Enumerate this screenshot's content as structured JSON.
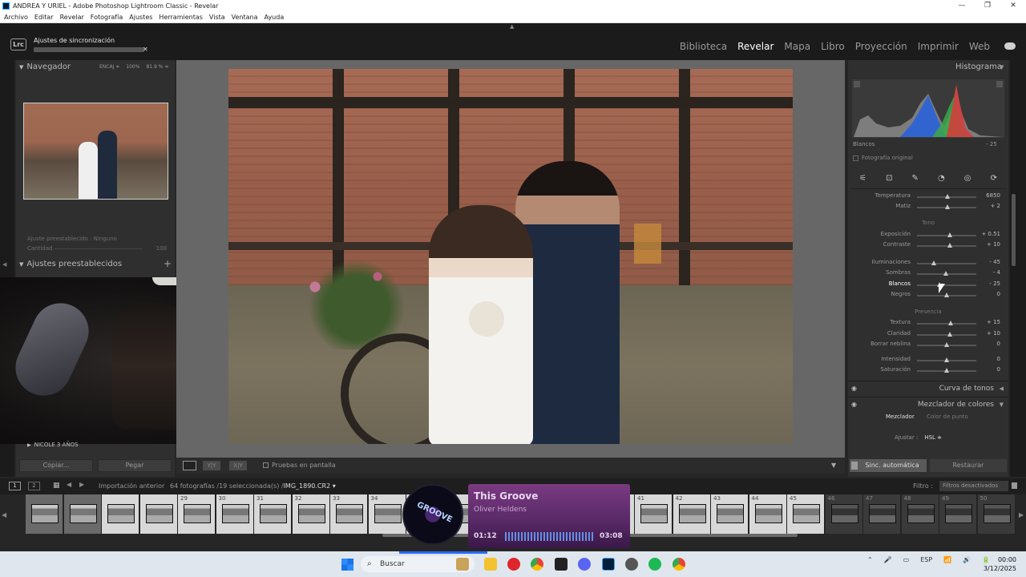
{
  "window": {
    "title": "ANDREA Y URIEL - Adobe Photoshop Lightroom Classic - Revelar",
    "controls": [
      "—",
      "❐",
      "✕"
    ]
  },
  "menu": [
    "Archivo",
    "Editar",
    "Revelar",
    "Fotografía",
    "Ajustes",
    "Herramientas",
    "Vista",
    "Ventana",
    "Ayuda"
  ],
  "identity": {
    "logo": "Lrc",
    "sync_label": "Ajustes de sincronización",
    "close": "✕"
  },
  "modules": [
    "Biblioteca",
    "Revelar",
    "Mapa",
    "Libro",
    "Proyección",
    "Imprimir",
    "Web"
  ],
  "active_module": "Revelar",
  "left": {
    "navigator_title": "Navegador",
    "zoom_options": [
      "ENCAJ ≑",
      "100%",
      "81.9 % ≑"
    ],
    "preset_mini": {
      "label": "Ajuste preestablecido",
      "value": "Ninguno",
      "amount_label": "Cantidad",
      "amount_value": "100"
    },
    "presets_title": "Ajustes preestablecidos",
    "presets_add": "+",
    "folder_item": "NICOLE 3 AÑOS",
    "copy_button": "Copiar...",
    "paste_button": "Pegar"
  },
  "center_toolbar": {
    "softproof": "Pruebas en pantalla",
    "view_yy": "Y|Y",
    "view_xy": "X|Y",
    "menu_arrow": "▼"
  },
  "right": {
    "histogram_title": "Histograma",
    "histogram_label": "Blancos",
    "histogram_value": "- 25",
    "original_photo": "Fotografía original",
    "tools": [
      "⚟",
      "⊡",
      "✎",
      "◔",
      "◎",
      "⟳"
    ],
    "rows_top": [
      {
        "label": "Temperatura",
        "value": "6850",
        "pos": 0.52
      },
      {
        "label": "Matiz",
        "value": "+ 2",
        "pos": 0.51
      }
    ],
    "tone_label": "Tono",
    "tone_rows": [
      {
        "label": "Exposición",
        "value": "+ 0.51",
        "pos": 0.56
      },
      {
        "label": "Contraste",
        "value": "+ 10",
        "pos": 0.55
      }
    ],
    "tone_rows2": [
      {
        "label": "Iluminaciones",
        "value": "- 45",
        "pos": 0.28
      },
      {
        "label": "Sombras",
        "value": "- 4",
        "pos": 0.48
      },
      {
        "label": "Blancos",
        "value": "- 25",
        "pos": 0.38
      },
      {
        "label": "Negros",
        "value": "0",
        "pos": 0.5
      }
    ],
    "presence_label": "Presencia",
    "presence_rows": [
      {
        "label": "Textura",
        "value": "+ 15",
        "pos": 0.57
      },
      {
        "label": "Claridad",
        "value": "+ 10",
        "pos": 0.55
      },
      {
        "label": "Borrar neblina",
        "value": "0",
        "pos": 0.5
      }
    ],
    "color_rows": [
      {
        "label": "Intensidad",
        "value": "0",
        "pos": 0.5
      },
      {
        "label": "Saturación",
        "value": "0",
        "pos": 0.5
      }
    ],
    "tone_curve": "Curva de tonos",
    "color_mixer": "Mezclador de colores",
    "mixer_tab_1": "Mezclador",
    "mixer_tab_2": "Color de punto",
    "adjust_label": "Ajustar :",
    "adjust_value": "HSL ≑",
    "sync_auto": "Sinc. automática",
    "reset": "Restaurar"
  },
  "filmstrip_nav": {
    "page1": "1",
    "page2": "2",
    "source": "Importación anterior",
    "count_text": "64 fotografías /19 seleccionada(s) /",
    "file": "IMG_1890.CR2 ▾",
    "filter_label": "Filtro :",
    "filter_value": "Filtros desactivados"
  },
  "filmstrip": [
    {
      "n": "",
      "state": "sel2"
    },
    {
      "n": "",
      "state": "sel2"
    },
    {
      "n": "",
      "state": "sel"
    },
    {
      "n": "",
      "state": "sel"
    },
    {
      "n": "29",
      "state": "sel"
    },
    {
      "n": "30",
      "state": "sel"
    },
    {
      "n": "31",
      "state": "sel"
    },
    {
      "n": "32",
      "state": "sel"
    },
    {
      "n": "33",
      "state": "sel"
    },
    {
      "n": "34",
      "state": "sel"
    },
    {
      "n": "",
      "state": "sel"
    },
    {
      "n": "",
      "state": "sel"
    },
    {
      "n": "",
      "state": "sel"
    },
    {
      "n": "",
      "state": "sel"
    },
    {
      "n": "",
      "state": "sel"
    },
    {
      "n": "",
      "state": "sel"
    },
    {
      "n": "41",
      "state": "sel"
    },
    {
      "n": "42",
      "state": "sel"
    },
    {
      "n": "43",
      "state": "sel"
    },
    {
      "n": "44",
      "state": "sel"
    },
    {
      "n": "45",
      "state": "sel"
    },
    {
      "n": "46",
      "state": "dark"
    },
    {
      "n": "47",
      "state": "dark"
    },
    {
      "n": "48",
      "state": "dark"
    },
    {
      "n": "49",
      "state": "dark"
    },
    {
      "n": "50",
      "state": "dark"
    }
  ],
  "music": {
    "disc_text": "GROOVE",
    "title": "This Groove",
    "artist": "Oliver Heldens",
    "current": "01:12",
    "total": "03:08"
  },
  "taskbar": {
    "search": "Buscar",
    "search_icon": "⌕",
    "tray_items": [
      "⌃",
      "🎤",
      "▭",
      "ESP",
      "📶",
      "🔊",
      "🔋"
    ],
    "time": "00:00",
    "date": "3/12/2025"
  },
  "colors": {
    "accent_blue": "#2a6bff",
    "music_purple": "#7a3a80"
  }
}
